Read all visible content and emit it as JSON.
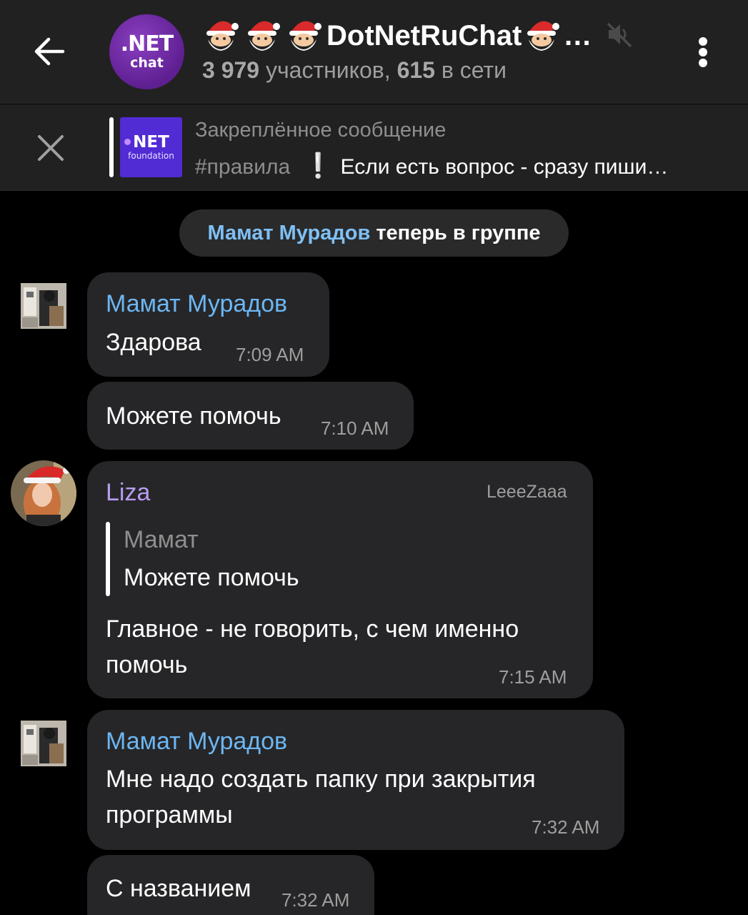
{
  "header": {
    "title": "DotNetRuChat",
    "title_prefix_emoji": [
      "santa-emoji",
      "santa-emoji",
      "santa-emoji"
    ],
    "title_suffix_emoji": "santa-emoji",
    "ellipsis": "…",
    "subtitle_members": "3 979",
    "subtitle_members_label": "участников,",
    "subtitle_online": "615",
    "subtitle_online_label": "в сети",
    "avatar_line1": ".NET",
    "avatar_line2": "chat",
    "muted": true
  },
  "pinned": {
    "title": "Закреплённое сообщение",
    "tag": "#правила",
    "text": "Если есть вопрос - сразу пиши…",
    "thumb_line1": "NET",
    "thumb_line2": "foundation"
  },
  "service_message": {
    "name": "Мамат Мурадов",
    "text": "теперь в группе"
  },
  "messages": [
    {
      "sender": "Мамат Мурадов",
      "text": "Здарова",
      "time": "7:09 AM"
    },
    {
      "text": "Можете помочь",
      "time": "7:10 AM"
    },
    {
      "sender": "Liza",
      "rank": "LeeeZaaa",
      "reply_name": "Мамат",
      "reply_text": "Можете помочь",
      "text_line1": "Главное - не говорить, с чем именно",
      "text_line2": "помочь",
      "time": "7:15 AM"
    },
    {
      "sender": "Мамат Мурадов",
      "text_line1": "Мне надо создать папку при закрытия",
      "text_line2": "программы",
      "time": "7:32 AM"
    },
    {
      "text": "С названием",
      "time": "7:32 AM"
    }
  ],
  "colors": {
    "header_bg": "#212121",
    "bubble_bg": "#262628",
    "sender_blue": "#6db6f2",
    "sender_purple": "#b79cf0",
    "accent_purple": "#5e1f91"
  }
}
